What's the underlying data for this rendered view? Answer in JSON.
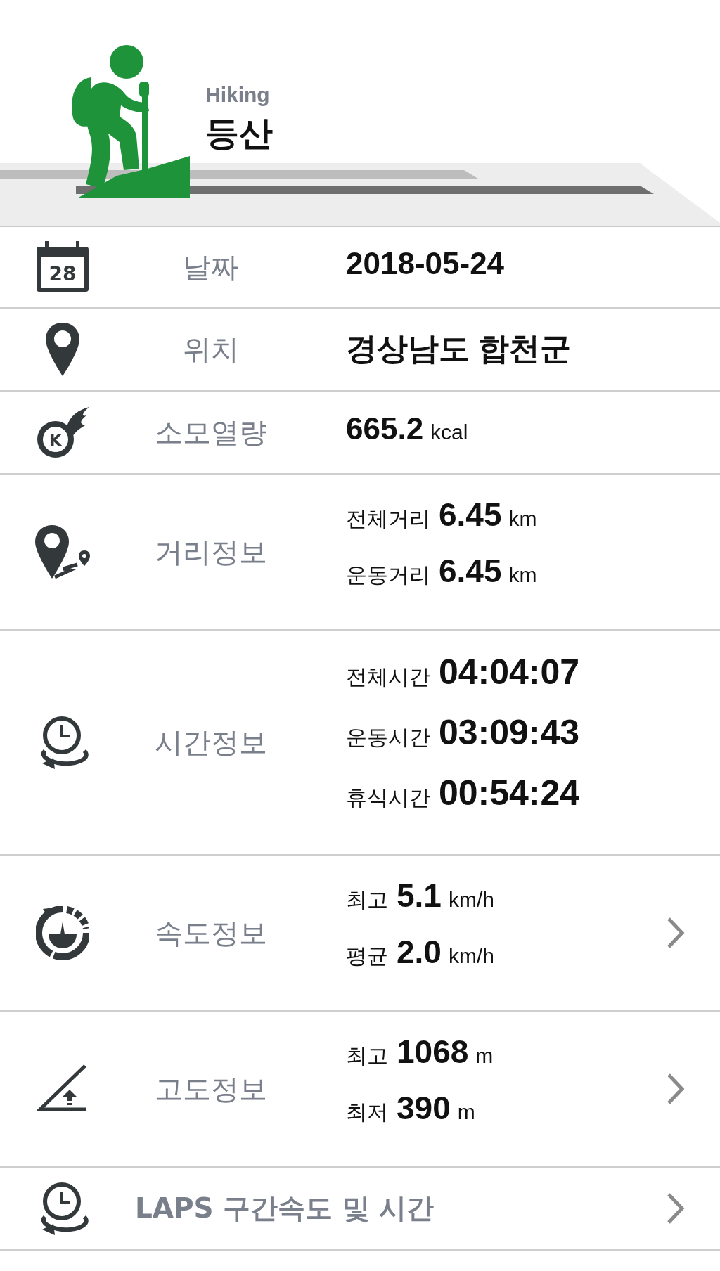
{
  "header": {
    "subtitle": "Hiking",
    "title": "등산"
  },
  "rows": [
    {
      "kind": "plain",
      "label": "날짜",
      "icon_text": "28",
      "lines": [
        {
          "value": "2018-05-24"
        }
      ],
      "link": false
    },
    {
      "kind": "plain",
      "label": "위치",
      "lines": [
        {
          "value": "경상남도 합천군"
        }
      ],
      "link": false
    },
    {
      "kind": "plain",
      "label": "소모열량",
      "icon_text": "K",
      "lines": [
        {
          "value": "665.2",
          "unit": "kcal"
        }
      ],
      "link": false
    },
    {
      "kind": "stats",
      "label": "거리정보",
      "lines": [
        {
          "name": "전체거리",
          "value": "6.45",
          "unit": "km"
        },
        {
          "name": "운동거리",
          "value": "6.45",
          "unit": "km"
        }
      ],
      "link": false
    },
    {
      "kind": "time",
      "label": "시간정보",
      "lines": [
        {
          "name": "전체시간",
          "value": "04:04:07"
        },
        {
          "name": "운동시간",
          "value": "03:09:43"
        },
        {
          "name": "휴식시간",
          "value": "00:54:24"
        }
      ],
      "link": false
    },
    {
      "kind": "stats",
      "label": "속도정보",
      "lines": [
        {
          "name": "최고",
          "value": "5.1",
          "unit": "km/h"
        },
        {
          "name": "평균",
          "value": "2.0",
          "unit": "km/h"
        }
      ],
      "link": true
    },
    {
      "kind": "stats",
      "label": "고도정보",
      "lines": [
        {
          "name": "최고",
          "value": "1068",
          "unit": "m"
        },
        {
          "name": "최저",
          "value": "390",
          "unit": "m"
        }
      ],
      "link": true
    },
    {
      "kind": "wide",
      "label": "LAPS 구간속도 및 시간",
      "link": true
    }
  ]
}
